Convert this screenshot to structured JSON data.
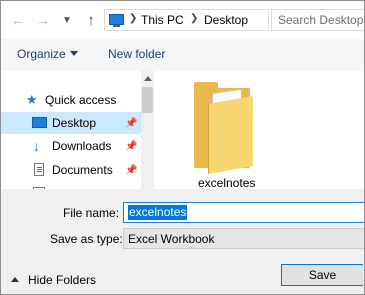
{
  "address": {
    "crumbs": [
      "This PC",
      "Desktop"
    ],
    "search_placeholder": "Search Desktop"
  },
  "toolbar": {
    "organize_label": "Organize",
    "new_folder_label": "New folder"
  },
  "nav": {
    "quick_access_label": "Quick access",
    "items": [
      {
        "label": "Desktop",
        "icon": "desktop-icon",
        "selected": true
      },
      {
        "label": "Downloads",
        "icon": "download-arrow-icon",
        "selected": false
      },
      {
        "label": "Documents",
        "icon": "document-icon",
        "selected": false
      }
    ]
  },
  "content": {
    "items": [
      {
        "name": "excelnotes",
        "icon": "folder-icon"
      }
    ]
  },
  "form": {
    "file_name_label": "File name:",
    "file_name_value": "excelnotes",
    "save_type_label": "Save as type:",
    "save_type_value": "Excel Workbook"
  },
  "footer": {
    "hide_folders_label": "Hide Folders",
    "save_label": "Save"
  },
  "colors": {
    "accent": "#0078d7",
    "selection": "#cce8ff",
    "folder": "#e8b94a"
  }
}
